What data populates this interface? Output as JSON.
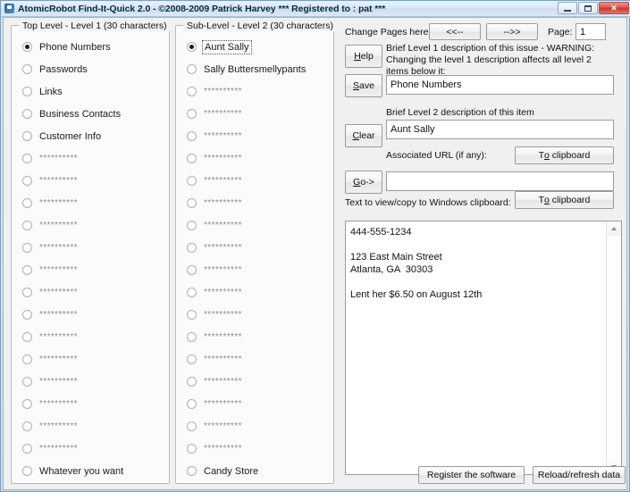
{
  "window": {
    "title": "AtomicRobot Find-It-Quick 2.0 - ©2008-2009 Patrick Harvey *** Registered to : pat ***",
    "app_icon": "app-icon",
    "minimize_label": "",
    "maximize_label": "",
    "close_label": "✕"
  },
  "level1": {
    "group_title": "Top Level - Level 1 (30 characters)",
    "selected_index": 0,
    "items": [
      {
        "label": "Phone Numbers",
        "placeholder": false
      },
      {
        "label": "Passwords",
        "placeholder": false
      },
      {
        "label": "Links",
        "placeholder": false
      },
      {
        "label": "Business Contacts",
        "placeholder": false
      },
      {
        "label": "Customer Info",
        "placeholder": false
      },
      {
        "label": "**********",
        "placeholder": true
      },
      {
        "label": "**********",
        "placeholder": true
      },
      {
        "label": "**********",
        "placeholder": true
      },
      {
        "label": "**********",
        "placeholder": true
      },
      {
        "label": "**********",
        "placeholder": true
      },
      {
        "label": "**********",
        "placeholder": true
      },
      {
        "label": "**********",
        "placeholder": true
      },
      {
        "label": "**********",
        "placeholder": true
      },
      {
        "label": "**********",
        "placeholder": true
      },
      {
        "label": "**********",
        "placeholder": true
      },
      {
        "label": "**********",
        "placeholder": true
      },
      {
        "label": "**********",
        "placeholder": true
      },
      {
        "label": "**********",
        "placeholder": true
      },
      {
        "label": "**********",
        "placeholder": true
      },
      {
        "label": "Whatever you want",
        "placeholder": false
      }
    ]
  },
  "level2": {
    "group_title": "Sub-Level - Level 2 (30 characters)",
    "selected_index": 0,
    "focused_index": 0,
    "items": [
      {
        "label": "Aunt Sally",
        "placeholder": false
      },
      {
        "label": "Sally Buttersmellypants",
        "placeholder": false
      },
      {
        "label": "**********",
        "placeholder": true
      },
      {
        "label": "**********",
        "placeholder": true
      },
      {
        "label": "**********",
        "placeholder": true
      },
      {
        "label": "**********",
        "placeholder": true
      },
      {
        "label": "**********",
        "placeholder": true
      },
      {
        "label": "**********",
        "placeholder": true
      },
      {
        "label": "**********",
        "placeholder": true
      },
      {
        "label": "**********",
        "placeholder": true
      },
      {
        "label": "**********",
        "placeholder": true
      },
      {
        "label": "**********",
        "placeholder": true
      },
      {
        "label": "**********",
        "placeholder": true
      },
      {
        "label": "**********",
        "placeholder": true
      },
      {
        "label": "**********",
        "placeholder": true
      },
      {
        "label": "**********",
        "placeholder": true
      },
      {
        "label": "**********",
        "placeholder": true
      },
      {
        "label": "**********",
        "placeholder": true
      },
      {
        "label": "**********",
        "placeholder": true
      },
      {
        "label": "Candy Store",
        "placeholder": false
      }
    ]
  },
  "right": {
    "change_pages_label": "Change Pages here:",
    "prev_page_button": "<<--",
    "next_page_button": "-->>",
    "page_label": "Page:",
    "page_value": "1",
    "help_button": "Help",
    "help_mnemonic": "H",
    "save_button": "Save",
    "save_mnemonic": "S",
    "clear_button": "Clear",
    "clear_mnemonic": "C",
    "go_button": "Go->",
    "go_mnemonic": "G",
    "level1_desc_label": "Brief Level 1 description of this issue - WARNING: Changing the level 1 description affects all level 2 items below it:",
    "level1_desc_value": "Phone Numbers",
    "level2_desc_label": "Brief Level 2 description of this item",
    "level2_desc_value": "Aunt Sally",
    "url_label": "Associated URL (if any):",
    "url_value": "",
    "url_clipboard_button": "To clipboard",
    "url_clipboard_mnemonic": "o",
    "bigtext_label": "Text to view/copy to Windows clipboard:",
    "bigtext_clipboard_button": "To clipboard",
    "bigtext_clipboard_mnemonic": "o",
    "bigtext_value": "444-555-1234\n\n123 East Main Street\nAtlanta, GA  30303\n\nLent her $6.50 on August 12th"
  },
  "bottom": {
    "register_button": "Register the software",
    "reload_button": "Reload/refresh data"
  }
}
